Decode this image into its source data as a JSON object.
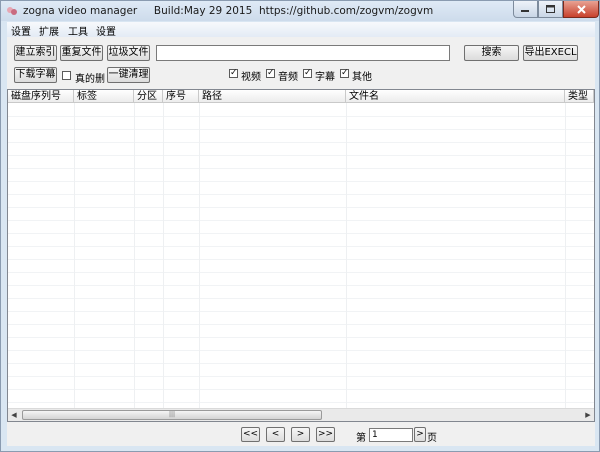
{
  "window": {
    "title": "zogna video manager     Build:May 29 2015  https://github.com/zogvm/zogvm"
  },
  "menu": [
    "设置",
    "扩展",
    "工具",
    "设置"
  ],
  "toolbar": {
    "build_index": "建立索引",
    "duplicate_files": "重复文件",
    "junk_files": "垃圾文件",
    "search": "搜索",
    "export": "导出EXECL",
    "download_subs": "下载字幕",
    "really_delete": "真的删",
    "one_click_clean": "一键清理",
    "search_value": ""
  },
  "filters": [
    {
      "label": "视频",
      "checked": true
    },
    {
      "label": "音频",
      "checked": true
    },
    {
      "label": "字幕",
      "checked": true
    },
    {
      "label": "其他",
      "checked": true
    }
  ],
  "really_delete_checked": false,
  "table": {
    "columns": [
      "磁盘序列号",
      "标签",
      "分区",
      "序号",
      "路径",
      "文件名",
      "类型"
    ],
    "rows": []
  },
  "scroll_thumb_glyph": "|||",
  "pagination": {
    "first": "<<",
    "prev": "<",
    "next": ">",
    "last": ">>",
    "page_prefix": "第",
    "page_value": "1",
    "go": ">",
    "page_suffix": "页"
  }
}
